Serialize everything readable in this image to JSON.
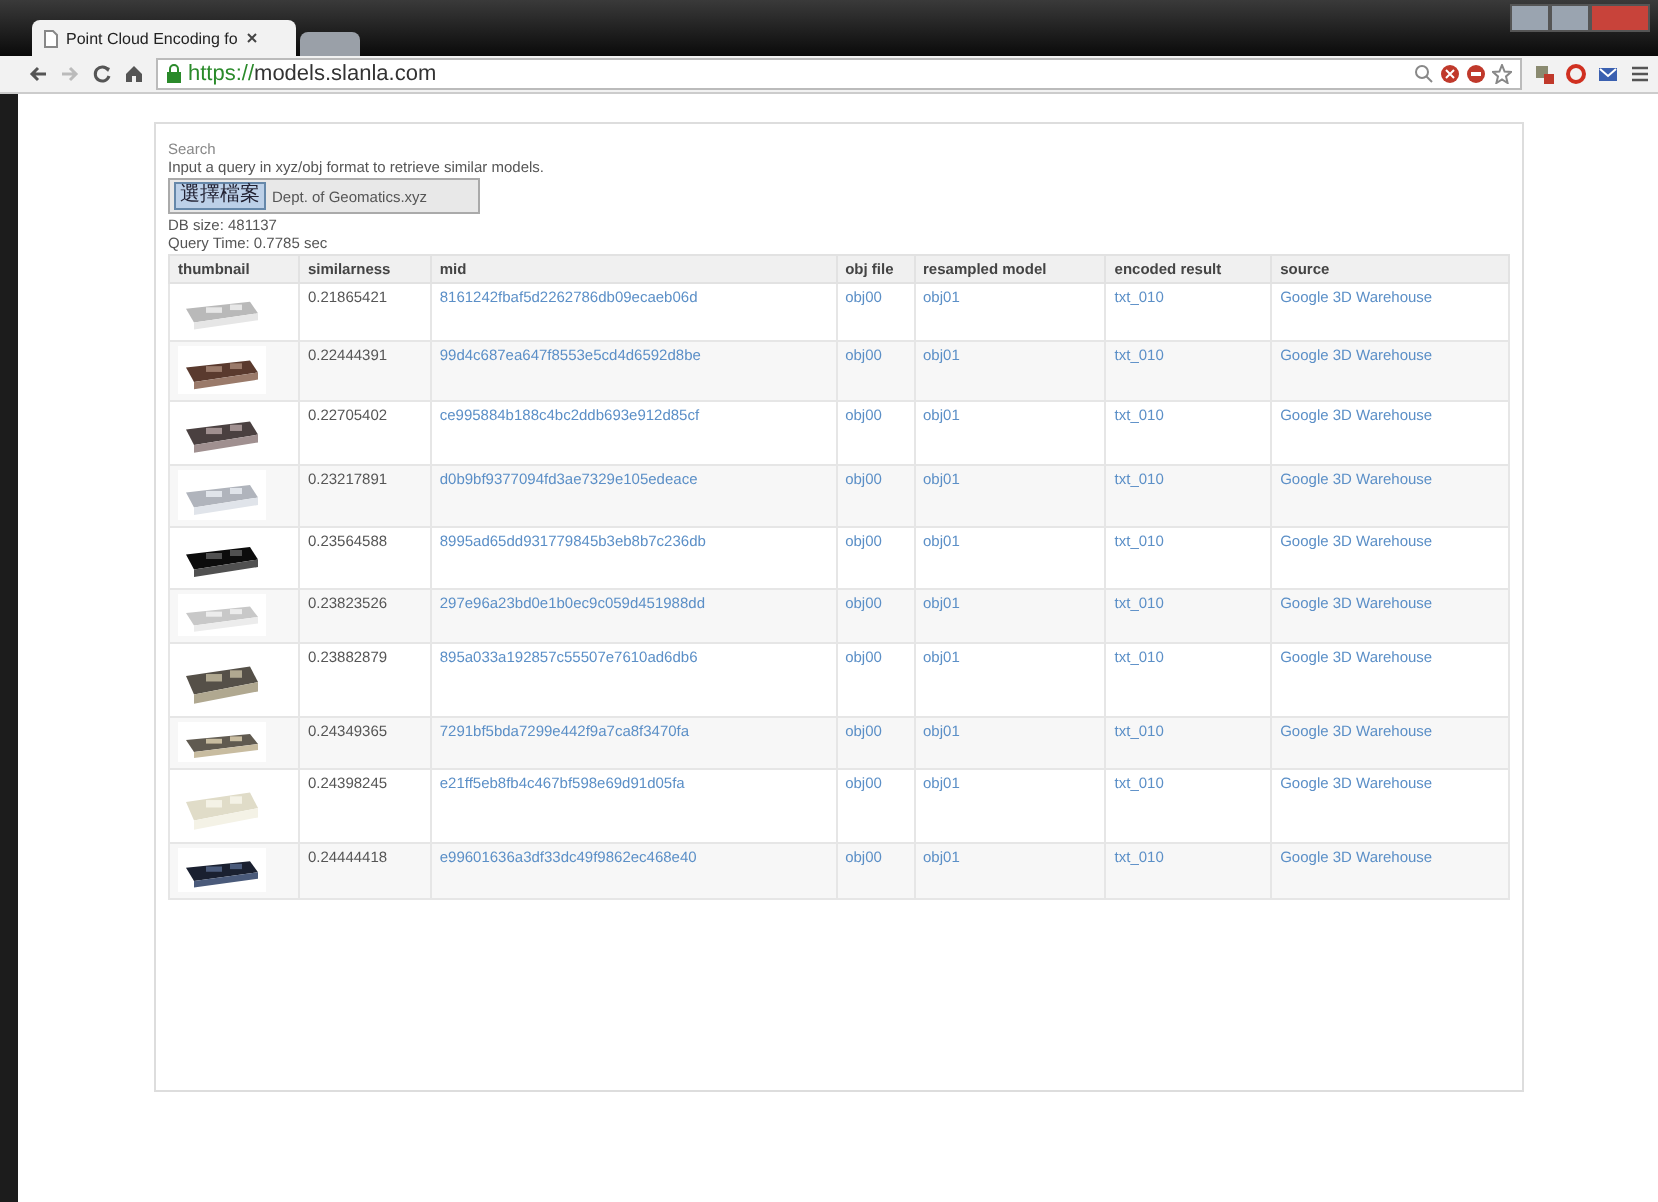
{
  "browser": {
    "tabs": [
      {
        "title": "Point Cloud Encoding fo",
        "selected": true
      },
      {
        "selected": false
      }
    ],
    "url_scheme": "https://",
    "url_host": "models.slanla.com"
  },
  "search": {
    "heading": "Search",
    "instruction": "Input a query in xyz/obj format to retrieve similar models.",
    "file_button": "選擇檔案",
    "file_name": "Dept. of Geomatics.xyz",
    "db_size": "DB size: 481137",
    "query_time": "Query Time: 0.7785 sec"
  },
  "table": {
    "columns": [
      "thumbnail",
      "similarness",
      "mid",
      "obj file",
      "resampled model",
      "encoded result",
      "source"
    ],
    "rows": [
      {
        "similarness": "0.21865421",
        "mid": "8161242fbaf5d2262786db09ecaeb06d",
        "obj_file": "obj00",
        "resampled_model": "obj01",
        "encoded_result": "txt_010",
        "source": "Google 3D Warehouse"
      },
      {
        "similarness": "0.22444391",
        "mid": "99d4c687ea647f8553e5cd4d6592d8be",
        "obj_file": "obj00",
        "resampled_model": "obj01",
        "encoded_result": "txt_010",
        "source": "Google 3D Warehouse"
      },
      {
        "similarness": "0.22705402",
        "mid": "ce995884b188c4bc2ddb693e912d85cf",
        "obj_file": "obj00",
        "resampled_model": "obj01",
        "encoded_result": "txt_010",
        "source": "Google 3D Warehouse"
      },
      {
        "similarness": "0.23217891",
        "mid": "d0b9bf9377094fd3ae7329e105edeace",
        "obj_file": "obj00",
        "resampled_model": "obj01",
        "encoded_result": "txt_010",
        "source": "Google 3D Warehouse"
      },
      {
        "similarness": "0.23564588",
        "mid": "8995ad65dd931779845b3eb8b7c236db",
        "obj_file": "obj00",
        "resampled_model": "obj01",
        "encoded_result": "txt_010",
        "source": "Google 3D Warehouse"
      },
      {
        "similarness": "0.23823526",
        "mid": "297e96a23bd0e1b0ec9c059d451988dd",
        "obj_file": "obj00",
        "resampled_model": "obj01",
        "encoded_result": "txt_010",
        "source": "Google 3D Warehouse"
      },
      {
        "similarness": "0.23882879",
        "mid": "895a033a192857c55507e7610ad6db6",
        "obj_file": "obj00",
        "resampled_model": "obj01",
        "encoded_result": "txt_010",
        "source": "Google 3D Warehouse"
      },
      {
        "similarness": "0.24349365",
        "mid": "7291bf5bda7299e442f9a7ca8f3470fa",
        "obj_file": "obj00",
        "resampled_model": "obj01",
        "encoded_result": "txt_010",
        "source": "Google 3D Warehouse"
      },
      {
        "similarness": "0.24398245",
        "mid": "e21ff5eb8fb4c467bf598e69d91d05fa",
        "obj_file": "obj00",
        "resampled_model": "obj01",
        "encoded_result": "txt_010",
        "source": "Google 3D Warehouse"
      },
      {
        "similarness": "0.24444418",
        "mid": "e99601636a3df33dc49f9862ec468e40",
        "obj_file": "obj00",
        "resampled_model": "obj01",
        "encoded_result": "txt_010",
        "source": "Google 3D Warehouse"
      }
    ]
  }
}
